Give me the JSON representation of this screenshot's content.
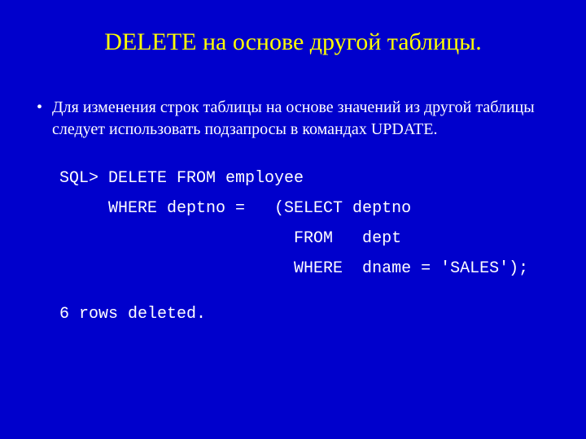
{
  "slide": {
    "title": "DELETE на основе другой таблицы.",
    "bullet": "Для изменения строк таблицы на основе значений из другой таблицы следует использовать подзапросы в командах UPDATE.",
    "code_line1": "SQL> DELETE FROM employee",
    "code_line2": "     WHERE deptno =   (SELECT deptno",
    "code_line3": "                        FROM   dept",
    "code_line4": "                        WHERE  dname = 'SALES');",
    "result": "6 rows deleted."
  }
}
